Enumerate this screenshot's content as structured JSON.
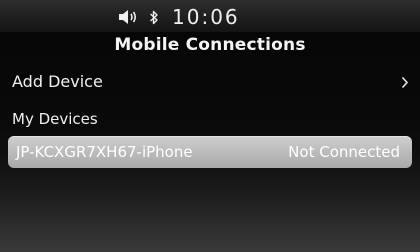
{
  "status_bar": {
    "time": "10:06",
    "icons": [
      "speaker-volume-icon",
      "bluetooth-icon"
    ]
  },
  "title": "Mobile Connections",
  "menu": {
    "add_device_label": "Add Device",
    "add_device_icon": "chevron-right-icon"
  },
  "my_devices": {
    "header": "My Devices",
    "devices": [
      {
        "name": "JP-KCXGR7XH67-iPhone",
        "status": "Not Connected"
      }
    ]
  },
  "colors": {
    "background": "#0a0a0a",
    "selected_row": "#bdbdbd",
    "text": "#f2f2f2"
  }
}
